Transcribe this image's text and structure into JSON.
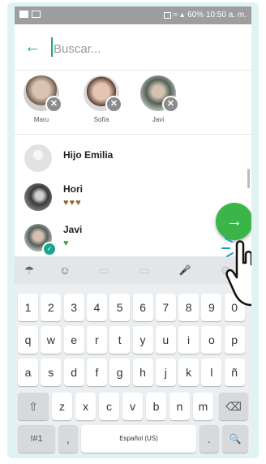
{
  "status_bar": {
    "text": "60% 10:50 a. m."
  },
  "search": {
    "placeholder": "Buscar..."
  },
  "selected_contacts": [
    {
      "name": "Maru",
      "color": "#b79a86"
    },
    {
      "name": "Sofía",
      "color": "#c9a28f"
    },
    {
      "name": "Javi",
      "color": "#8f9a8f"
    }
  ],
  "contacts": [
    {
      "name": "Hijo Emilia",
      "status": "",
      "color": "#e2e2e2"
    },
    {
      "name": "Hori",
      "status": "♥♥♥",
      "color": "#4a4a4a"
    },
    {
      "name": "Javi",
      "status": "♥",
      "color": "#7d8a7d"
    }
  ],
  "keyboard": {
    "toolbar": [
      "☂",
      "☺",
      "▭",
      "▭",
      "🎤",
      "⚙"
    ],
    "row_numbers": [
      "1",
      "2",
      "3",
      "4",
      "5",
      "6",
      "7",
      "8",
      "9",
      "0"
    ],
    "row_q": [
      "q",
      "w",
      "e",
      "r",
      "t",
      "y",
      "u",
      "i",
      "o",
      "p"
    ],
    "row_a": [
      "a",
      "s",
      "d",
      "f",
      "g",
      "h",
      "j",
      "k",
      "l",
      "ñ"
    ],
    "row_z": [
      "z",
      "x",
      "c",
      "v",
      "b",
      "n",
      "m"
    ],
    "shift": "⇧",
    "backspace": "⌫",
    "symbols": "!#1",
    "comma": ",",
    "space": "Español (US)",
    "period": ".",
    "search": "🔍"
  },
  "colors": {
    "accent": "#18a58b",
    "fab": "#3bb548"
  }
}
